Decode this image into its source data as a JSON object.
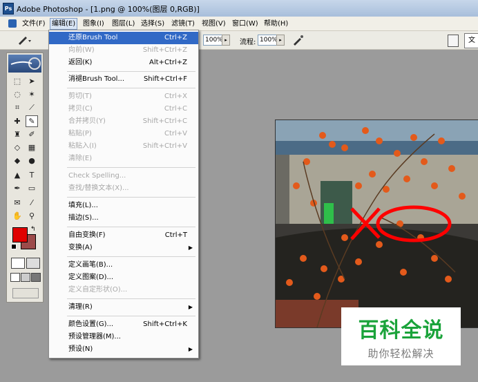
{
  "window": {
    "app_icon": "Ps",
    "title": "Adobe Photoshop - [1.png @ 100%(图层 0,RGB)]"
  },
  "menubar": [
    {
      "label": "文件(F)"
    },
    {
      "label": "编辑(E)"
    },
    {
      "label": "图象(I)"
    },
    {
      "label": "图层(L)"
    },
    {
      "label": "选择(S)"
    },
    {
      "label": "滤镜(T)"
    },
    {
      "label": "视图(V)"
    },
    {
      "label": "窗口(W)"
    },
    {
      "label": "帮助(H)"
    }
  ],
  "options": {
    "opacity_value": "100%",
    "flow_label": "流程:",
    "flow_value": "100%",
    "right_button": "文"
  },
  "edit_menu": {
    "items": [
      {
        "label": "还原Brush Tool",
        "shortcut": "Ctrl+Z",
        "disabled": false,
        "highlight": true
      },
      {
        "label": "向前(W)",
        "shortcut": "Shift+Ctrl+Z",
        "disabled": true
      },
      {
        "label": "返回(K)",
        "shortcut": "Alt+Ctrl+Z",
        "disabled": false
      },
      {
        "label": "消褪Brush Tool...",
        "shortcut": "Shift+Ctrl+F",
        "disabled": false
      },
      {
        "label": "剪切(T)",
        "shortcut": "Ctrl+X",
        "disabled": true
      },
      {
        "label": "拷贝(C)",
        "shortcut": "Ctrl+C",
        "disabled": true
      },
      {
        "label": "合并拷贝(Y)",
        "shortcut": "Shift+Ctrl+C",
        "disabled": true
      },
      {
        "label": "粘贴(P)",
        "shortcut": "Ctrl+V",
        "disabled": true
      },
      {
        "label": "粘贴入(I)",
        "shortcut": "Shift+Ctrl+V",
        "disabled": true
      },
      {
        "label": "清除(E)",
        "shortcut": "",
        "disabled": true
      },
      {
        "label": "Check Spelling...",
        "shortcut": "",
        "disabled": true
      },
      {
        "label": "查找/替换文本(X)...",
        "shortcut": "",
        "disabled": true
      },
      {
        "label": "填充(L)...",
        "shortcut": "",
        "disabled": false
      },
      {
        "label": "描边(S)...",
        "shortcut": "",
        "disabled": false
      },
      {
        "label": "自由变换(F)",
        "shortcut": "Ctrl+T",
        "disabled": false
      },
      {
        "label": "变换(A)",
        "shortcut": "",
        "disabled": false,
        "submenu": true
      },
      {
        "label": "定义画笔(B)...",
        "shortcut": "",
        "disabled": false
      },
      {
        "label": "定义图案(D)...",
        "shortcut": "",
        "disabled": false
      },
      {
        "label": "定义自定形状(O)...",
        "shortcut": "",
        "disabled": true
      },
      {
        "label": "清理(R)",
        "shortcut": "",
        "disabled": false,
        "submenu": true
      },
      {
        "label": "颜色设置(G)...",
        "shortcut": "Shift+Ctrl+K",
        "disabled": false
      },
      {
        "label": "预设管理器(M)...",
        "shortcut": "",
        "disabled": false
      },
      {
        "label": "预设(N)",
        "shortcut": "",
        "disabled": false,
        "submenu": true
      }
    ]
  },
  "watermark": {
    "title": "百科全说",
    "subtitle": "助你轻松解决"
  },
  "colors": {
    "foreground": "#e00000",
    "background": "#9c4a4a",
    "highlight": "#3169c6",
    "stroke": "#ff0000"
  }
}
